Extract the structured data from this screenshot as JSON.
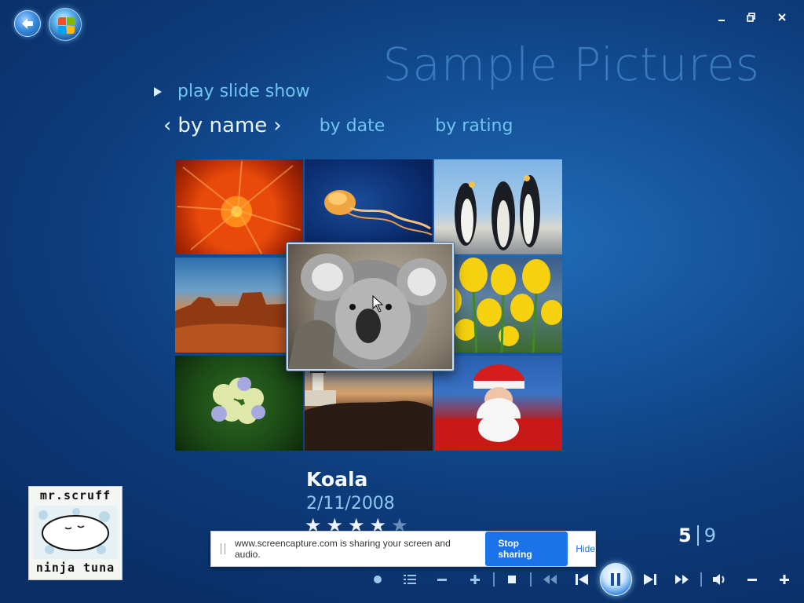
{
  "window": {
    "minimize_icon": "minimize-icon",
    "restore_icon": "restore-icon",
    "close_icon": "close-icon"
  },
  "header": {
    "title": "Sample Pictures"
  },
  "actions": {
    "play_slide_show": "play slide show"
  },
  "sort": {
    "active": "by name",
    "options": [
      "by date",
      "by rating"
    ]
  },
  "grid": {
    "tiles": [
      "Chrysanthemum",
      "Jellyfish",
      "Penguins",
      "Desert",
      "Koala",
      "Tulips",
      "Hydrangeas",
      "Lighthouse",
      "Santa"
    ],
    "focused_index": 4
  },
  "caption": {
    "title": "Koala",
    "date": "2/11/2008",
    "rating": 4,
    "rating_max": 5
  },
  "album": {
    "line1": "mr.scruff",
    "line2": "ninja tuna"
  },
  "counter": {
    "current": "5",
    "total": "9"
  },
  "share_bar": {
    "message": "www.screencapture.com is sharing your screen and audio.",
    "stop_label": "Stop sharing",
    "hide_label": "Hide"
  },
  "transport": {
    "icons": [
      "dot-icon",
      "list-icon",
      "minus-icon",
      "plus-icon",
      "stop-icon",
      "rewind-icon",
      "previous-icon",
      "pause-icon",
      "next-icon",
      "fast-forward-icon",
      "volume-icon",
      "volume-down-icon",
      "volume-up-icon"
    ]
  },
  "colors": {
    "accent": "#6fc4f2",
    "background": "#155198",
    "share_button": "#1a73e8"
  }
}
